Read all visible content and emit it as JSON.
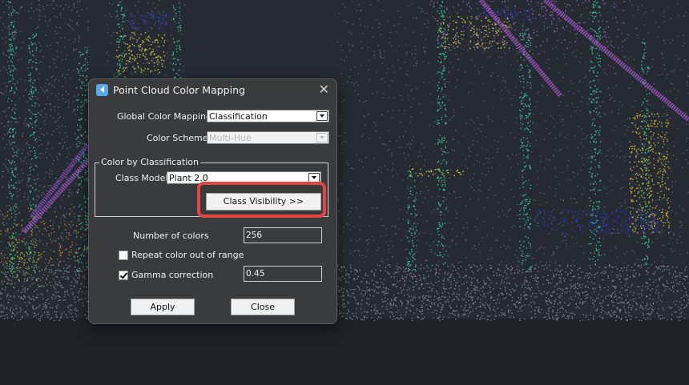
{
  "dialog": {
    "title": "Point Cloud Color Mapping",
    "icon": "app-back-icon",
    "close_icon": "close-icon",
    "global_color_mapping": {
      "label": "Global Color Mapping",
      "value": "Classification"
    },
    "color_scheme": {
      "label": "Color Scheme",
      "value": "Multi-Hue",
      "enabled": false
    },
    "color_by_classification": {
      "group_title": "Color by Classification",
      "class_model_label": "Class Model",
      "class_model_value": "Plant 2.0",
      "class_visibility_button": "Class Visibility >>"
    },
    "number_of_colors": {
      "label": "Number of colors",
      "value": "256"
    },
    "repeat_color": {
      "label": "Repeat color out of range",
      "checked": false
    },
    "gamma_correction": {
      "label": "Gamma correction",
      "checked": true,
      "value": "0.45"
    },
    "buttons": {
      "apply": "Apply",
      "close": "Close"
    }
  },
  "highlight_color": "#e2463f",
  "background_color": "#262b33"
}
